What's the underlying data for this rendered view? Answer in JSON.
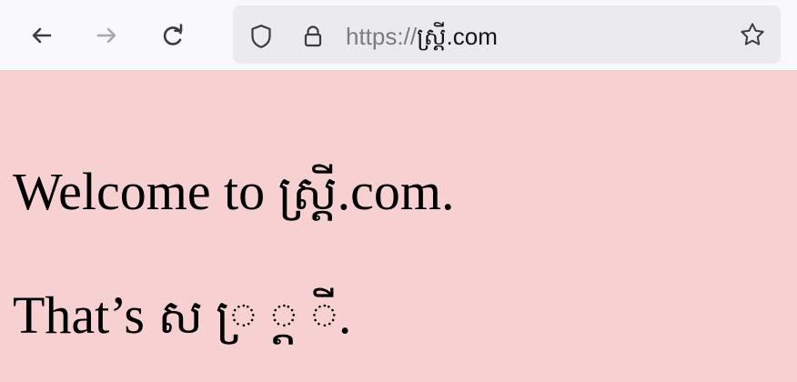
{
  "browser": {
    "nav": {
      "back_icon": "arrow-left-icon",
      "forward_icon": "arrow-right-icon",
      "reload_icon": "refresh-icon"
    },
    "url": {
      "scheme": "https://",
      "host": "ស្ត្រី.com",
      "shield_icon": "shield-icon",
      "lock_icon": "lock-icon",
      "bookmark_icon": "star-icon"
    }
  },
  "page": {
    "background_color": "#f7d1d2",
    "line1": {
      "prefix": "Welcome to ",
      "khmer_word": "ស្ត្រី",
      "suffix": ".com."
    },
    "line2": {
      "prefix": "That’s ",
      "part1": "ស",
      "part2": "្រ",
      "part3": "្ត",
      "part4": "ី",
      "suffix": "."
    }
  }
}
